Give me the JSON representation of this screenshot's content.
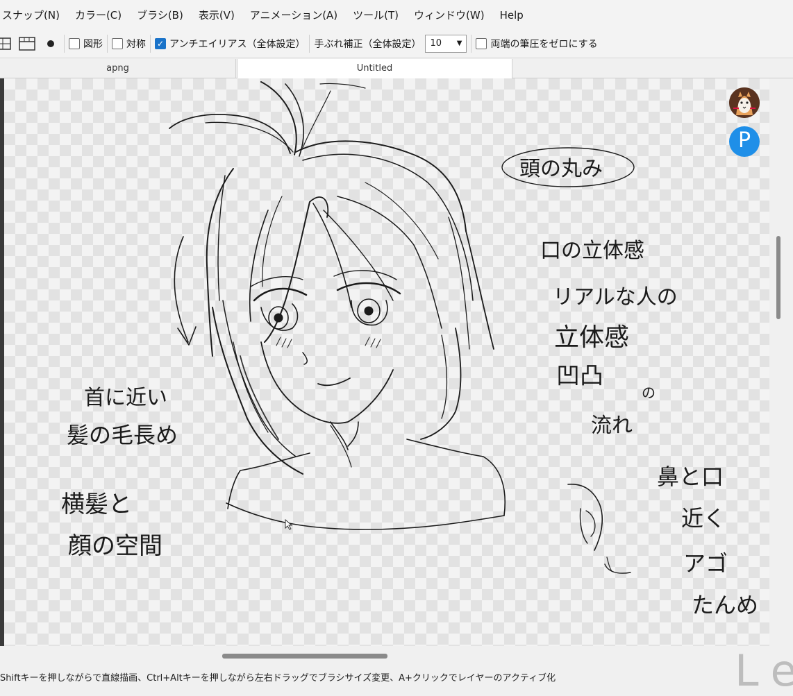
{
  "menu": [
    "スナップ(N)",
    "カラー(C)",
    "ブラシ(B)",
    "表示(V)",
    "アニメーション(A)",
    "ツール(T)",
    "ウィンドウ(W)",
    "Help"
  ],
  "toolbar": {
    "shape_label": "図形",
    "symmetry_label": "対称",
    "antialias_label": "アンチエイリアス（全体設定）",
    "stabilizer_label": "手ぶれ補正（全体設定）",
    "stabilizer_value": "10",
    "pressure_zero_label": "両端の筆圧をゼロにする",
    "shape_checked": false,
    "symmetry_checked": false,
    "antialias_checked": true,
    "pressure_zero_checked": false
  },
  "tabs": [
    {
      "label": "apng",
      "active": false
    },
    {
      "label": "Untitled",
      "active": true
    }
  ],
  "canvas": {
    "annotations": {
      "head_roundness": "頭の丸み",
      "mouth_depth": "口の立体感",
      "real_depth_1": "リアルな人の",
      "real_depth_2": "立体感",
      "real_depth_3": "凹凸",
      "real_depth_4": "の",
      "real_depth_5": "流れ",
      "neck_hair_1": "首に近い",
      "neck_hair_2": "髪の毛長め",
      "side_hair_1": "横髪と",
      "side_hair_2": "顔の空間",
      "nose_1": "鼻と口",
      "nose_2": "近く",
      "nose_3": "アゴ",
      "nose_4": "たんめ"
    }
  },
  "overlay": {
    "p_avatar_letter": "P"
  },
  "status": {
    "text": "Shiftキーを押しながらで直線描画、Ctrl+Altキーを押しながら左右ドラッグでブラシサイズ変更、A+クリックでレイヤーのアクティブ化"
  },
  "watermark": "Le"
}
